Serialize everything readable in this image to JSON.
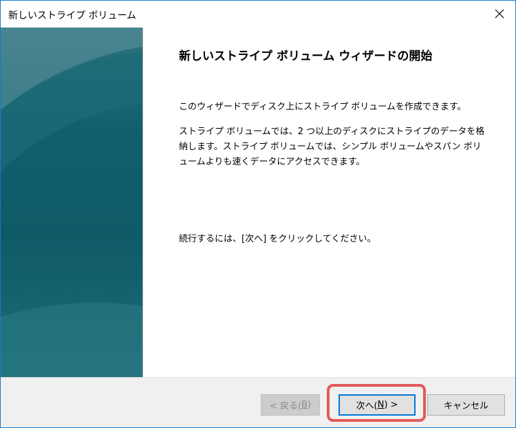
{
  "window": {
    "title": "新しいストライプ ボリューム"
  },
  "wizard": {
    "heading": "新しいストライプ ボリューム ウィザードの開始",
    "para1": "このウィザードでディスク上にストライプ ボリュームを作成できます。",
    "para2": "ストライプ ボリュームでは、2 つ以上のディスクにストライプのデータを格納します。ストライプ ボリュームでは、シンプル ボリュームやスパン ボリュームよりも速くデータにアクセスできます。",
    "para3": "続行するには、[次へ] をクリックしてください。"
  },
  "buttons": {
    "back": {
      "pre": "< 戻る(",
      "key": "B",
      "post": ")"
    },
    "next": {
      "pre": "次へ(",
      "key": "N",
      "post": ") >"
    },
    "cancel": "キャンセル"
  },
  "colors": {
    "accent": "#0078d7",
    "sidebar": "#0f5f6e",
    "highlight": "#e4595b"
  }
}
